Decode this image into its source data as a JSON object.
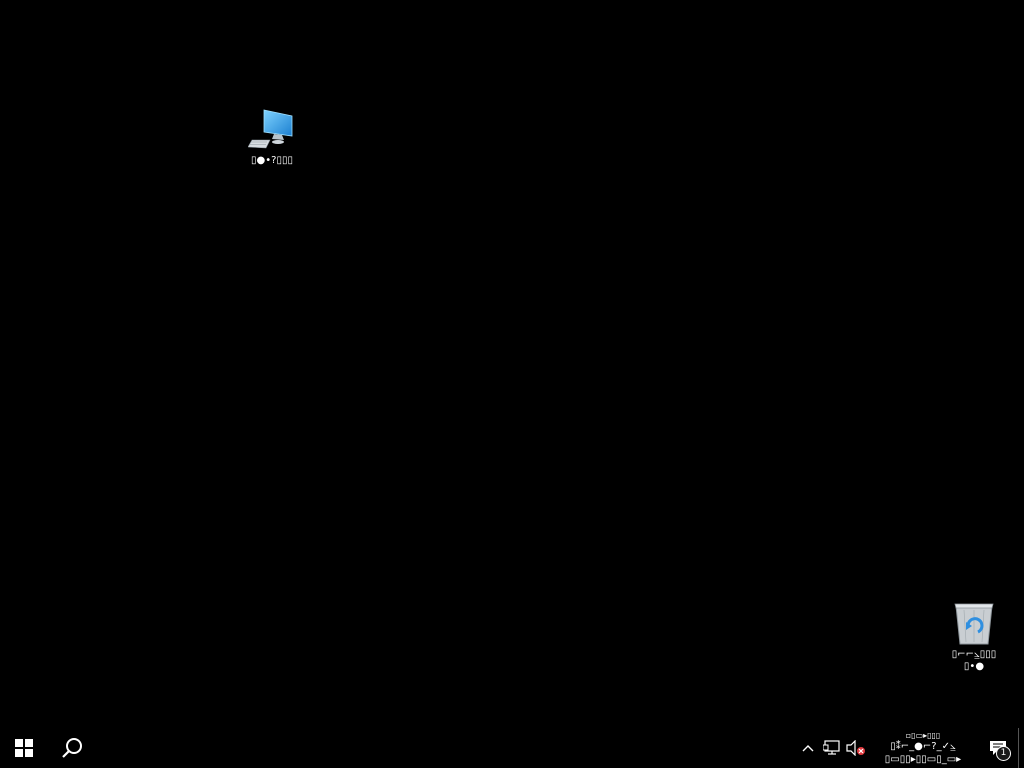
{
  "desktop": {
    "background_color": "#000000",
    "icons": [
      {
        "name": "This PC",
        "label": "▯●•?▯▯▯",
        "icon": "computer-icon"
      },
      {
        "name": "Recycle Bin",
        "label": "▯⌐⌐⦥▯▯▯\n▯•●",
        "icon": "recycle-bin-icon"
      }
    ]
  },
  "taskbar": {
    "background_color": "#000000",
    "start_icon": "windows-logo-icon",
    "search_icon": "search-icon",
    "tray": {
      "icons": [
        "chevron-up-icon",
        "network-icon",
        "volume-muted-icon"
      ],
      "clock_line1": "▯⁑⌐_●⌐?_✓⦥",
      "clock_line2": "▯▭▯▯▸▯▯▭▯_▭▸",
      "clock_top": "▫▯▭▸▯▯▯",
      "action_center_icon": "notification-icon",
      "notification_count": "1"
    }
  },
  "colors": {
    "accent_blue": "#3aa8f0",
    "text": "#ffffff",
    "muted_red": "#e0393e"
  }
}
